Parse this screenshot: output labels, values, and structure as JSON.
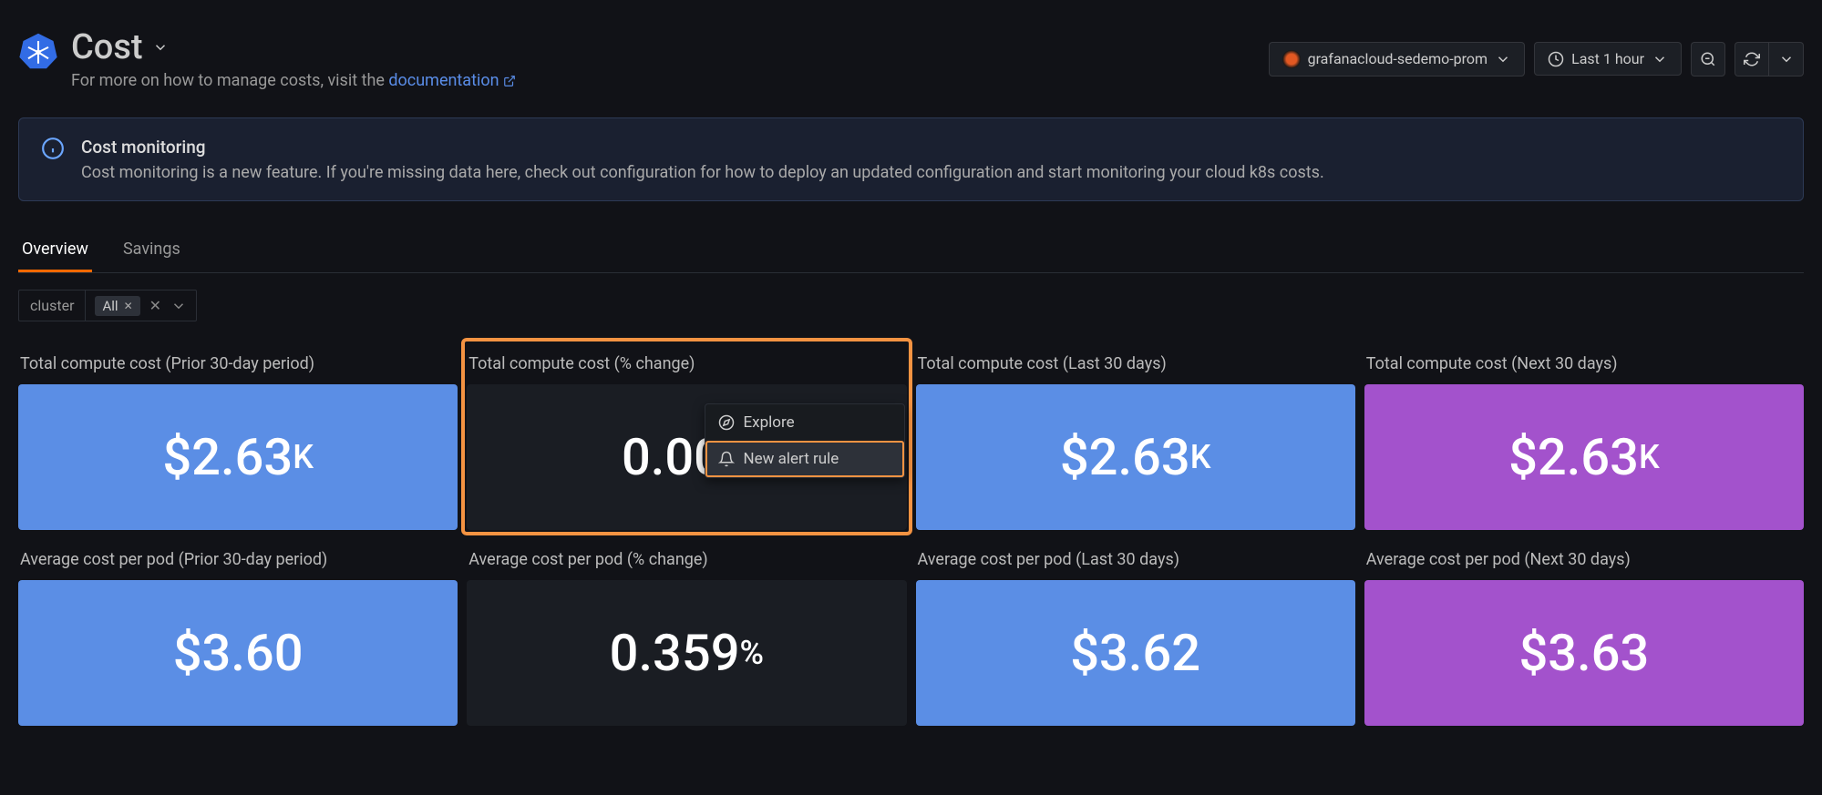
{
  "header": {
    "title": "Cost",
    "subtitle_prefix": "For more on how to manage costs, visit the ",
    "subtitle_link": "documentation",
    "datasource": "grafanacloud-sedemo-prom",
    "time_range": "Last 1 hour"
  },
  "banner": {
    "title": "Cost monitoring",
    "body": "Cost monitoring is a new feature. If you're missing data here, check out configuration for how to deploy an updated configuration and start monitoring your cloud k8s costs."
  },
  "tabs": [
    {
      "label": "Overview",
      "active": true
    },
    {
      "label": "Savings",
      "active": false
    }
  ],
  "filter": {
    "label": "cluster",
    "chip": "All"
  },
  "panels": [
    {
      "title": "Total compute cost (Prior 30-day period)",
      "value": "$2.63",
      "unit": "K",
      "color": "blue"
    },
    {
      "title": "Total compute cost (% change)",
      "value": "0.003",
      "unit": "",
      "color": "dark",
      "highlighted": true,
      "menu": true
    },
    {
      "title": "Total compute cost (Last 30 days)",
      "value": "$2.63",
      "unit": "K",
      "color": "blue"
    },
    {
      "title": "Total compute cost (Next 30 days)",
      "value": "$2.63",
      "unit": "K",
      "color": "purple"
    },
    {
      "title": "Average cost per pod (Prior 30-day period)",
      "value": "$3.60",
      "unit": "",
      "color": "blue"
    },
    {
      "title": "Average cost per pod (% change)",
      "value": "0.359",
      "unit": "%",
      "color": "dark"
    },
    {
      "title": "Average cost per pod (Last 30 days)",
      "value": "$3.62",
      "unit": "",
      "color": "blue"
    },
    {
      "title": "Average cost per pod (Next 30 days)",
      "value": "$3.63",
      "unit": "",
      "color": "purple"
    }
  ],
  "context_menu": {
    "explore": "Explore",
    "new_alert": "New alert rule"
  },
  "colors": {
    "blue": "#5b8ee5",
    "purple": "#a352cc",
    "highlight": "#f49342"
  }
}
